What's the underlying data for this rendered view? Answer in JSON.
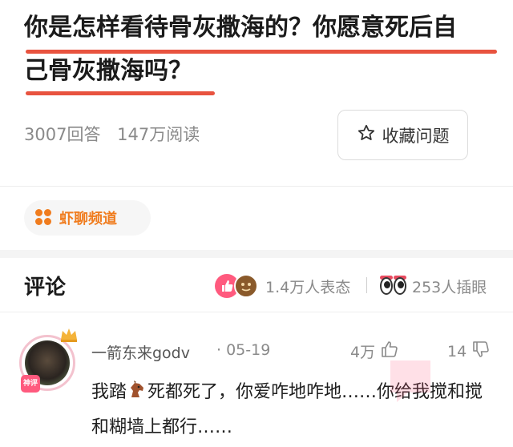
{
  "question": {
    "title_line1": "你是怎样看待骨灰撒海的？你愿意死后自",
    "title_line2": "己骨灰撒海吗？",
    "answers": "3007回答",
    "reads": "147万阅读",
    "favorite_label": "收藏问题"
  },
  "channel": {
    "label": "虾聊频道"
  },
  "comments_header": {
    "title": "评论",
    "reactions": "1.4万人表态",
    "glances": "253人插眼"
  },
  "comment": {
    "username": "一箭东来godv",
    "date": "· 05-19",
    "likes": "4万",
    "dislikes": "14",
    "avatar_badge": "神评",
    "text_before_emoji": "我踏",
    "text_after_emoji": "死都死了，你爱咋地咋地……你给我搅和搅和糊墙上都行……"
  },
  "colors": {
    "accent_red": "#e8533f",
    "channel_orange": "#f07c1e",
    "reaction_pink": "#ff5a7e",
    "reaction_brown": "#8a5a2b",
    "brow_red": "#e84a5f"
  },
  "icons": {
    "favorite": "star-outline-icon",
    "channel": "four-dots-icon",
    "like": "thumbs-up-icon",
    "dislike": "thumbs-down-icon",
    "emoji": "horse-emoji-icon",
    "glance": "eyes-icon",
    "crown": "crown-icon"
  }
}
